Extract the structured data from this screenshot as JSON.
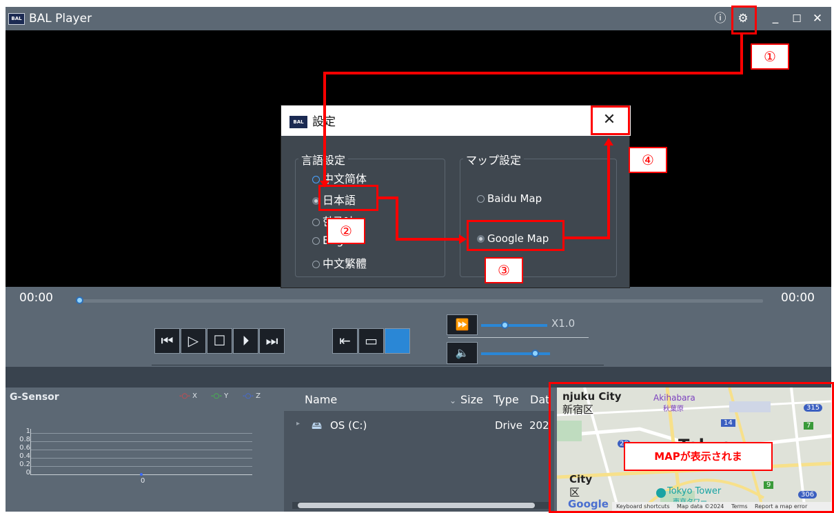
{
  "window": {
    "title": "BAL Player",
    "logo_text": "BAL"
  },
  "titlebar": {
    "info_icon": "ⓘ",
    "settings_icon": "⚙",
    "minimize": "_",
    "maximize": "☐",
    "close": "✕"
  },
  "player": {
    "time_start": "00:00",
    "time_end": "00:00",
    "speed_label": "X1.0",
    "progress": 0,
    "speed_level": 0.35,
    "volume_level": 0.78
  },
  "dialog": {
    "title": "設定",
    "close": "✕",
    "language_group": "言語設定",
    "languages": [
      "中文简体",
      "日本語",
      "한국어",
      "English",
      "中文繁體"
    ],
    "language_visible": [
      "中文简体",
      "日本語",
      "한국어",
      "English",
      "中文繁體"
    ],
    "selected_language": "日本語",
    "map_group": "マップ設定",
    "maps": [
      "Baidu Map",
      "Google Map"
    ],
    "selected_map": "Google Map"
  },
  "gsensor": {
    "title": "G-Sensor",
    "legend": [
      "X",
      "Y",
      "Z"
    ],
    "y_ticks": [
      "1",
      "0.8",
      "0.6",
      "0.4",
      "0.2",
      "0"
    ],
    "x_tick": "0",
    "colors": {
      "x": "#ff3b3b",
      "y": "#3bdc3b",
      "z": "#3b6bff"
    }
  },
  "filelist": {
    "columns": [
      "Name",
      "Size",
      "Type",
      "Dat"
    ],
    "rows": [
      {
        "name": "OS (C:)",
        "type": "Drive",
        "date": "202"
      }
    ]
  },
  "map": {
    "labels": {
      "shinjuku": "njuku City",
      "shinjuku_jp": "新宿区",
      "akihabara": "Akihabara",
      "akihabara_jp": "秋葉原",
      "tokyo": "Tokyo",
      "city": "City",
      "ku": "区",
      "tower": "Tokyo Tower",
      "tower_jp": "東京タワー",
      "r315": "315",
      "r14": "14",
      "r7": "7",
      "r20": "20",
      "r9": "9",
      "r306": "306",
      "google": "Google",
      "footer_shortcuts": "Keyboard shortcuts",
      "footer_data": "Map data ©2024",
      "footer_terms": "Terms",
      "footer_report": "Report a map error"
    },
    "overlay_text": "MAPが表示されま"
  },
  "annotations": {
    "step1": "①",
    "step2": "②",
    "step3": "③",
    "step4": "④",
    "color": "#ff0000"
  }
}
